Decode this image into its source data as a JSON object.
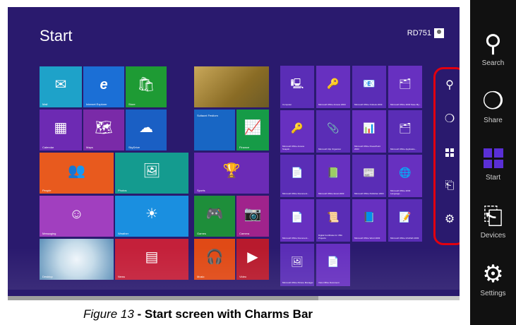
{
  "start": {
    "title": "Start",
    "user": "RD751"
  },
  "tiles": {
    "mail": "Mail",
    "ie": "Internet Explorer",
    "store": "Store",
    "travel": "",
    "calendar": "Calendar",
    "maps": "Maps",
    "skydrive": "SkyDrive",
    "stock_title": "Sultacnt Festiom",
    "finance": "Finance",
    "people": "People",
    "photos": "Photos",
    "sports": "Sports",
    "messaging": "Messaging",
    "weather": "Weather",
    "games": "Games",
    "camera": "Camera",
    "desktop": "Desktop",
    "news": "News",
    "music": "Music",
    "video": "Video"
  },
  "apps": [
    "Computer",
    "Microsoft Office Access 2003",
    "Microsoft Office Outlook 2003",
    "Microsoft Office 2003 Save My...",
    "Microsoft Office Access Snapsh...",
    "Microsoft Clip Organizer",
    "Microsoft Office PowerPoint 2003",
    "Microsoft Office Applicatio...",
    "Microsoft Office Document...",
    "Microsoft Office Excel 2003",
    "Microsoft Office Publisher 2003",
    "Microsoft Office 2003 Language...",
    "Microsoft Office Document...",
    "Digital Certificate for VBA Projects",
    "Microsoft Office Word 2003",
    "Microsoft Office InfoPath 2003",
    "Microsoft Office Picture Manager",
    "Visio Office Document"
  ],
  "charms": {
    "search": "Search",
    "share": "Share",
    "start": "Start",
    "devices": "Devices",
    "settings": "Settings"
  },
  "caption": {
    "italic": "Figure 13",
    "bold": " - Start screen with Charms Bar"
  },
  "colors": {
    "background": "#2a1a6e",
    "highlight": "#e2000f",
    "charms_bg": "#111111"
  }
}
